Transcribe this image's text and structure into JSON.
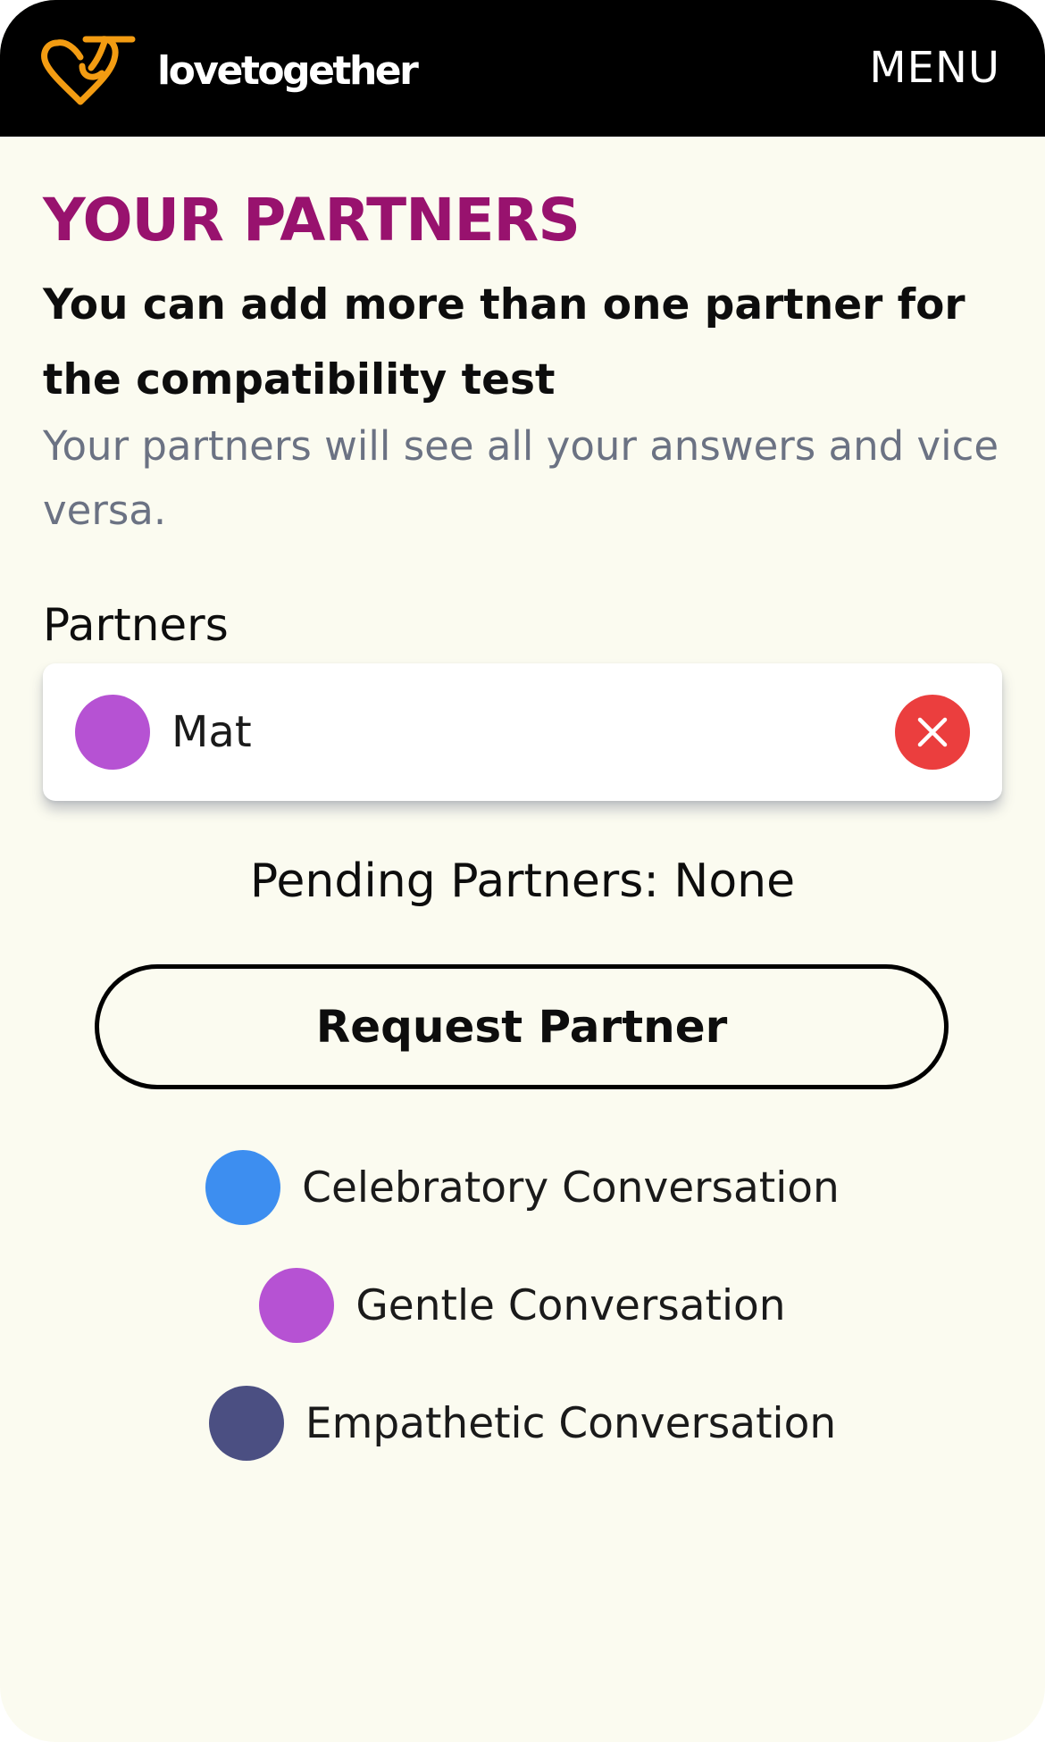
{
  "header": {
    "brand": "lovetogether",
    "menu_label": "MENU"
  },
  "main": {
    "title": "YOUR PARTNERS",
    "subtitle": "You can add more than one partner for the compatibility test",
    "description": "Your partners will see all your answers and vice versa.",
    "partners_label": "Partners",
    "partners": [
      {
        "name": "Mat",
        "color": "#b652d3"
      }
    ],
    "pending_label": "Pending Partners:",
    "pending_value": "None",
    "request_button_label": "Request Partner"
  },
  "legend": [
    {
      "label": "Celebratory Conversation",
      "color": "#3d8ef0"
    },
    {
      "label": "Gentle Conversation",
      "color": "#b652d3"
    },
    {
      "label": "Empathetic Conversation",
      "color": "#4b4f82"
    }
  ],
  "colors": {
    "brand_accent": "#f39c12",
    "title": "#98126e",
    "remove": "#eb3e3e",
    "background": "#fbfbf0"
  },
  "icons": {
    "logo": "heart-logo-icon",
    "remove": "close-icon"
  }
}
